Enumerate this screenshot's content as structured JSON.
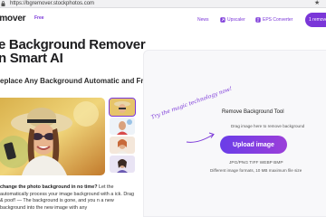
{
  "browser": {
    "url": "https://bgremover.stockphotos.com",
    "star_icon": "★"
  },
  "header": {
    "logo": "e Background Remover",
    "logo_short": "emover",
    "logo_badge": "Free",
    "nav": {
      "news": "News",
      "upscaler": "Upscaler",
      "eps": "EPS Converter"
    },
    "cta_label": "1 remove"
  },
  "hero": {
    "title_line1": "e Background Remover",
    "title_line2": "n Smart AI",
    "subtitle": "eplace Any Background Automatic and Free",
    "body_bold": "change the photo background in no time?",
    "body_rest": " Let the automatically process your image background with a ick. Drag & poof! — The background is gone, and you n a new background into the new image with any"
  },
  "tool": {
    "magic_note": "Try the magic technology now!",
    "title": "Remove Background Tool",
    "hint": "Drag image here to remove background",
    "upload_label": "Upload image",
    "formats": "JPG/PNG TIFF WEBP BMP",
    "limits": "Different image formats, 10 MB maximum file size"
  },
  "colors": {
    "accent": "#7a36d8",
    "button_gradient_start": "#6a3de8",
    "button_gradient_end": "#9b3fd9"
  }
}
